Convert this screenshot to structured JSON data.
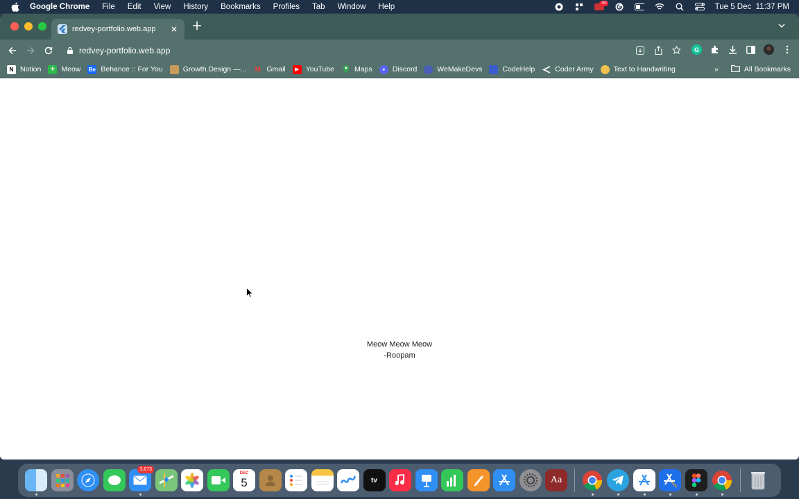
{
  "menubar": {
    "app_name": "Google Chrome",
    "items": [
      "File",
      "Edit",
      "View",
      "History",
      "Bookmarks",
      "Profiles",
      "Tab",
      "Window",
      "Help"
    ],
    "clock": "Tue 5 Dec  11:37 PM",
    "badge": ".00"
  },
  "browser": {
    "tab_title": "redvey-portfolio.web.app",
    "url": "redvey-portfolio.web.app",
    "bookmarks": [
      {
        "label": "Notion",
        "icon": "notion-icon",
        "color": "#ffffff"
      },
      {
        "label": "Meow",
        "icon": "plus-icon",
        "color": "#2db84b"
      },
      {
        "label": "Behance :: For You",
        "icon": "behance-icon",
        "color": "#1769ff"
      },
      {
        "label": "Growth.Design —...",
        "icon": "growth-design-icon",
        "color": "#c79a5a"
      },
      {
        "label": "Gmail",
        "icon": "gmail-icon",
        "color": "#ea4335"
      },
      {
        "label": "YouTube",
        "icon": "youtube-icon",
        "color": "#ff0000"
      },
      {
        "label": "Maps",
        "icon": "maps-icon",
        "color": "#34a853"
      },
      {
        "label": "Discord",
        "icon": "discord-icon",
        "color": "#5865f2"
      },
      {
        "label": "WeMakeDevs",
        "icon": "wemakedevs-icon",
        "color": "#6b4cff"
      },
      {
        "label": "CodeHelp",
        "icon": "codehelp-icon",
        "color": "#3a5ccc"
      },
      {
        "label": "Coder Army",
        "icon": "coder-army-icon",
        "color": "#ffffff"
      },
      {
        "label": "Text to Handwriting",
        "icon": "handwriting-icon",
        "color": "#f2c14e"
      }
    ],
    "all_bookmarks": "All Bookmarks",
    "overflow": "»"
  },
  "page": {
    "quote_line1": "Meow Meow Meow",
    "quote_line2": "-Roopam"
  },
  "dock": {
    "mail_badge": "3,673",
    "calendar_month": "DEC",
    "calendar_day": "5",
    "tv_label": "tv",
    "dictionary_label": "Aa"
  }
}
